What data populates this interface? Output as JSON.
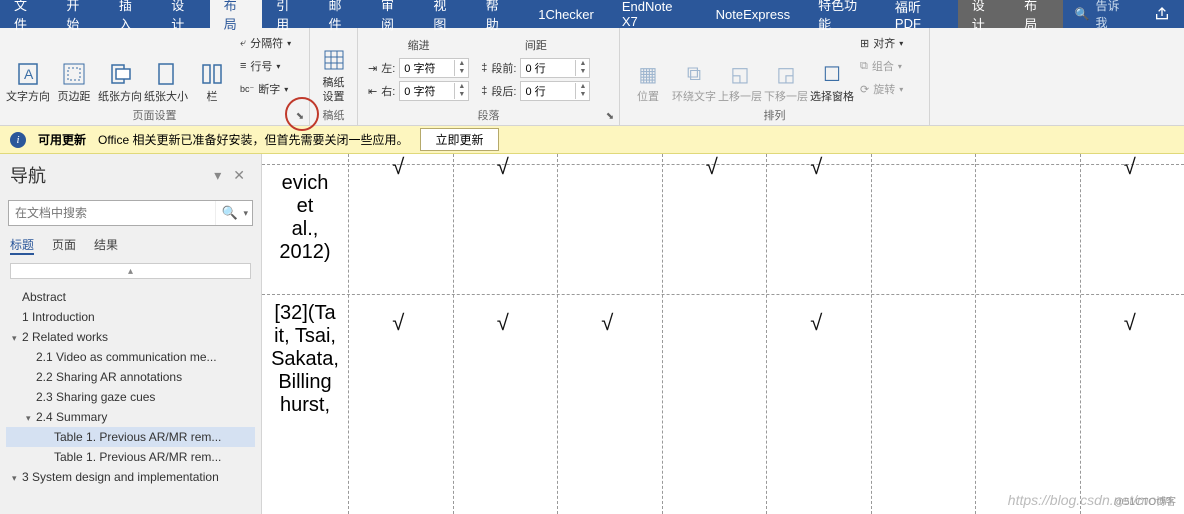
{
  "tabs": {
    "items": [
      "文件",
      "开始",
      "插入",
      "设计",
      "布局",
      "引用",
      "邮件",
      "审阅",
      "视图",
      "帮助",
      "1Checker",
      "EndNote X7",
      "NoteExpress",
      "特色功能",
      "福昕PDF"
    ],
    "contextual": [
      "设计",
      "布局"
    ],
    "active": "布局",
    "tell_me": "告诉我",
    "search_glyph": "🔍"
  },
  "ribbon": {
    "page_setup": {
      "label": "页面设置",
      "text_dir": "文字方向",
      "margins": "页边距",
      "orientation": "纸张方向",
      "size": "纸张大小",
      "columns": "栏",
      "breaks": "分隔符",
      "line_num": "行号",
      "hyphen": "断字"
    },
    "manuscript": {
      "label": "稿纸",
      "btn": "稿纸\n设置"
    },
    "paragraph": {
      "label": "段落",
      "indent_title": "缩进",
      "spacing_title": "间距",
      "left_label": "左:",
      "right_label": "右:",
      "left_val": "0 字符",
      "right_val": "0 字符",
      "before_label": "段前:",
      "after_label": "段后:",
      "before_val": "0 行",
      "after_val": "0 行"
    },
    "arrange": {
      "label": "排列",
      "position": "位置",
      "wrap": "环绕文字",
      "forward": "上移一层",
      "backward": "下移一层",
      "selection_pane": "选择窗格",
      "align": "对齐",
      "group": "组合",
      "rotate": "旋转"
    }
  },
  "update_bar": {
    "title": "可用更新",
    "msg": "Office 相关更新已准备好安装，但首先需要关闭一些应用。",
    "btn": "立即更新"
  },
  "nav": {
    "title": "导航",
    "search_placeholder": "在文档中搜索",
    "tabs": [
      "标题",
      "页面",
      "结果"
    ],
    "tree": [
      {
        "level": 1,
        "caret": "",
        "text": "Abstract"
      },
      {
        "level": 1,
        "caret": "",
        "text": "1 Introduction"
      },
      {
        "level": 1,
        "caret": "▾",
        "text": "2 Related works"
      },
      {
        "level": 2,
        "caret": "",
        "text": "2.1 Video as communication me..."
      },
      {
        "level": 2,
        "caret": "",
        "text": "2.2 Sharing AR annotations"
      },
      {
        "level": 2,
        "caret": "",
        "text": "2.3 Sharing gaze cues"
      },
      {
        "level": 2,
        "caret": "▾",
        "text": "2.4 Summary"
      },
      {
        "level": 3,
        "caret": "",
        "text": "Table 1. Previous AR/MR rem...",
        "selected": true
      },
      {
        "level": 3,
        "caret": "",
        "text": "Table 1. Previous AR/MR rem..."
      },
      {
        "level": 1,
        "caret": "▾",
        "text": "3 System design and implementation"
      }
    ]
  },
  "doc": {
    "row1_text": "evich et al., 2012)",
    "row2_text": "[32](Ta it, Tsai, Sakata, Billing hurst,",
    "checks_row1": [
      true,
      true,
      false,
      true,
      true,
      false,
      false,
      true
    ],
    "checks_row2": [
      true,
      true,
      true,
      false,
      true,
      false,
      false,
      true
    ]
  },
  "watermark": "https://blog.csdn.net/moon",
  "corner": "@51CTO博客"
}
